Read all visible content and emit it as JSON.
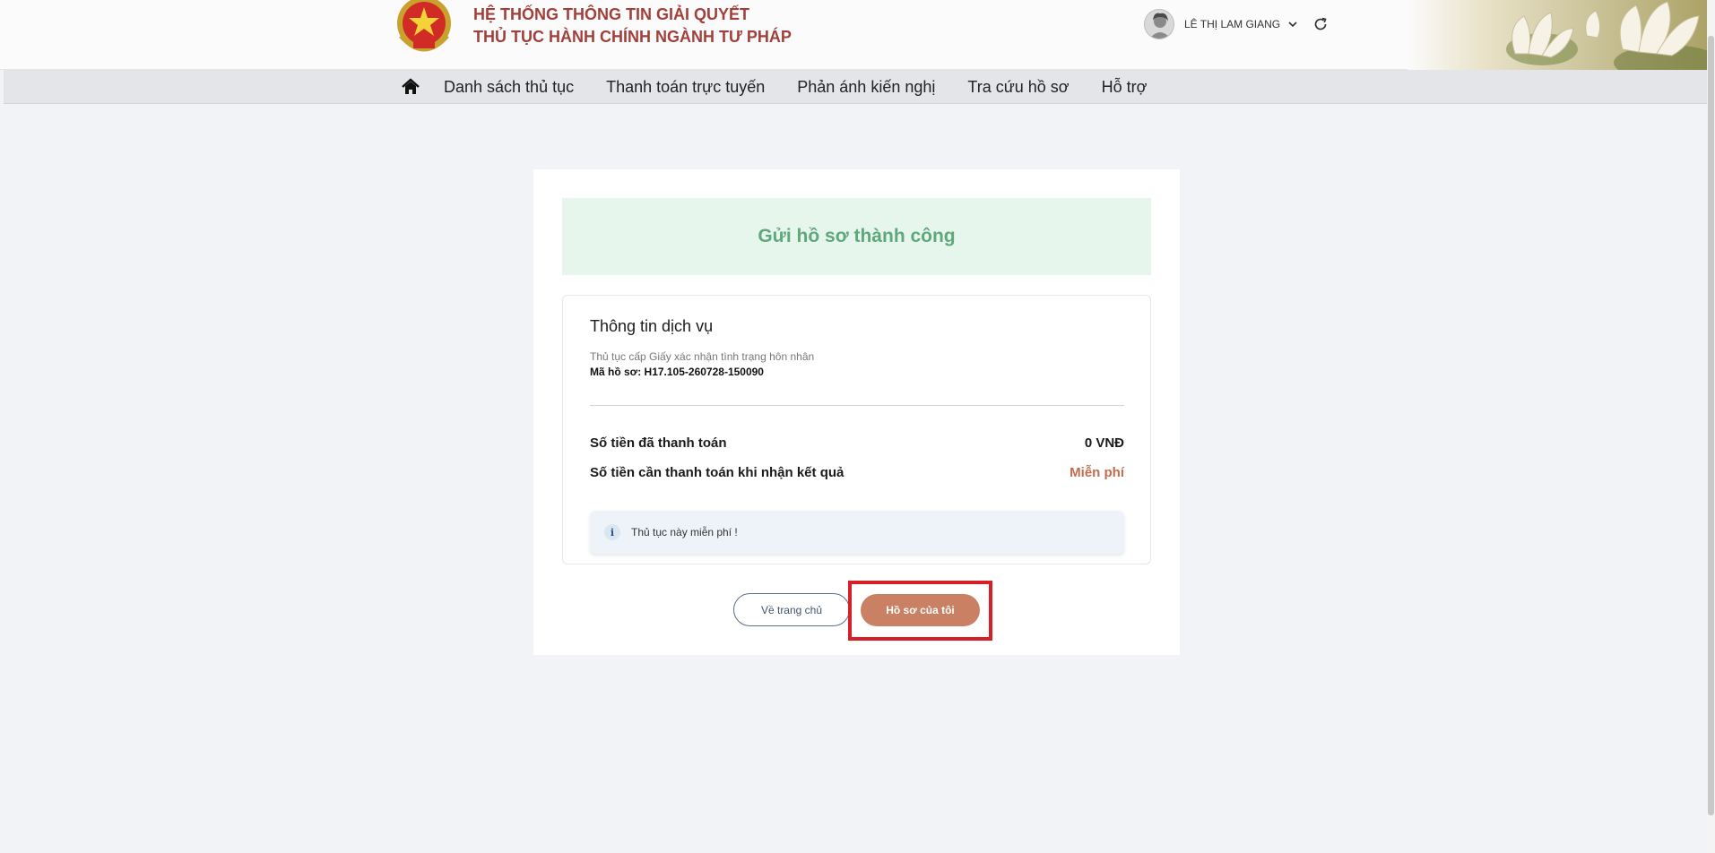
{
  "header": {
    "title_line1": "HỆ THỐNG THÔNG TIN GIẢI QUYẾT",
    "title_line2": "THỦ TỤC HÀNH CHÍNH NGÀNH TƯ PHÁP",
    "user_name": "LÊ THỊ LAM GIANG",
    "emblem_icon": "national-emblem",
    "avatar_icon": "user-avatar",
    "refresh_icon": "refresh-icon"
  },
  "nav": {
    "items": [
      {
        "label": "Danh sách thủ tục"
      },
      {
        "label": "Thanh toán trực tuyến"
      },
      {
        "label": "Phản ánh kiến nghị"
      },
      {
        "label": "Tra cứu hồ sơ"
      },
      {
        "label": "Hỗ trợ"
      }
    ]
  },
  "main": {
    "success_message": "Gửi hồ sơ thành công",
    "service": {
      "title": "Thông tin dịch vụ",
      "procedure": "Thủ tục cấp Giấy xác nhận tình trạng hôn nhân",
      "case_code": "Mã hồ sơ: H17.105-260728-150090"
    },
    "payment": {
      "paid_label": "Số tiền đã thanh toán",
      "paid_value": "0 VNĐ",
      "due_label": "Số tiền cần thanh toán khi nhận kết quả",
      "due_value": "Miễn phí"
    },
    "notice": "Thủ tục này miễn phí !",
    "buttons": {
      "home": "Về trang chủ",
      "my_records": "Hồ sơ của tôi"
    }
  },
  "colors": {
    "title_red": "#a1403a",
    "success_green": "#5fa87b",
    "accent_button": "#c98063",
    "highlight_red": "#d61f26"
  }
}
